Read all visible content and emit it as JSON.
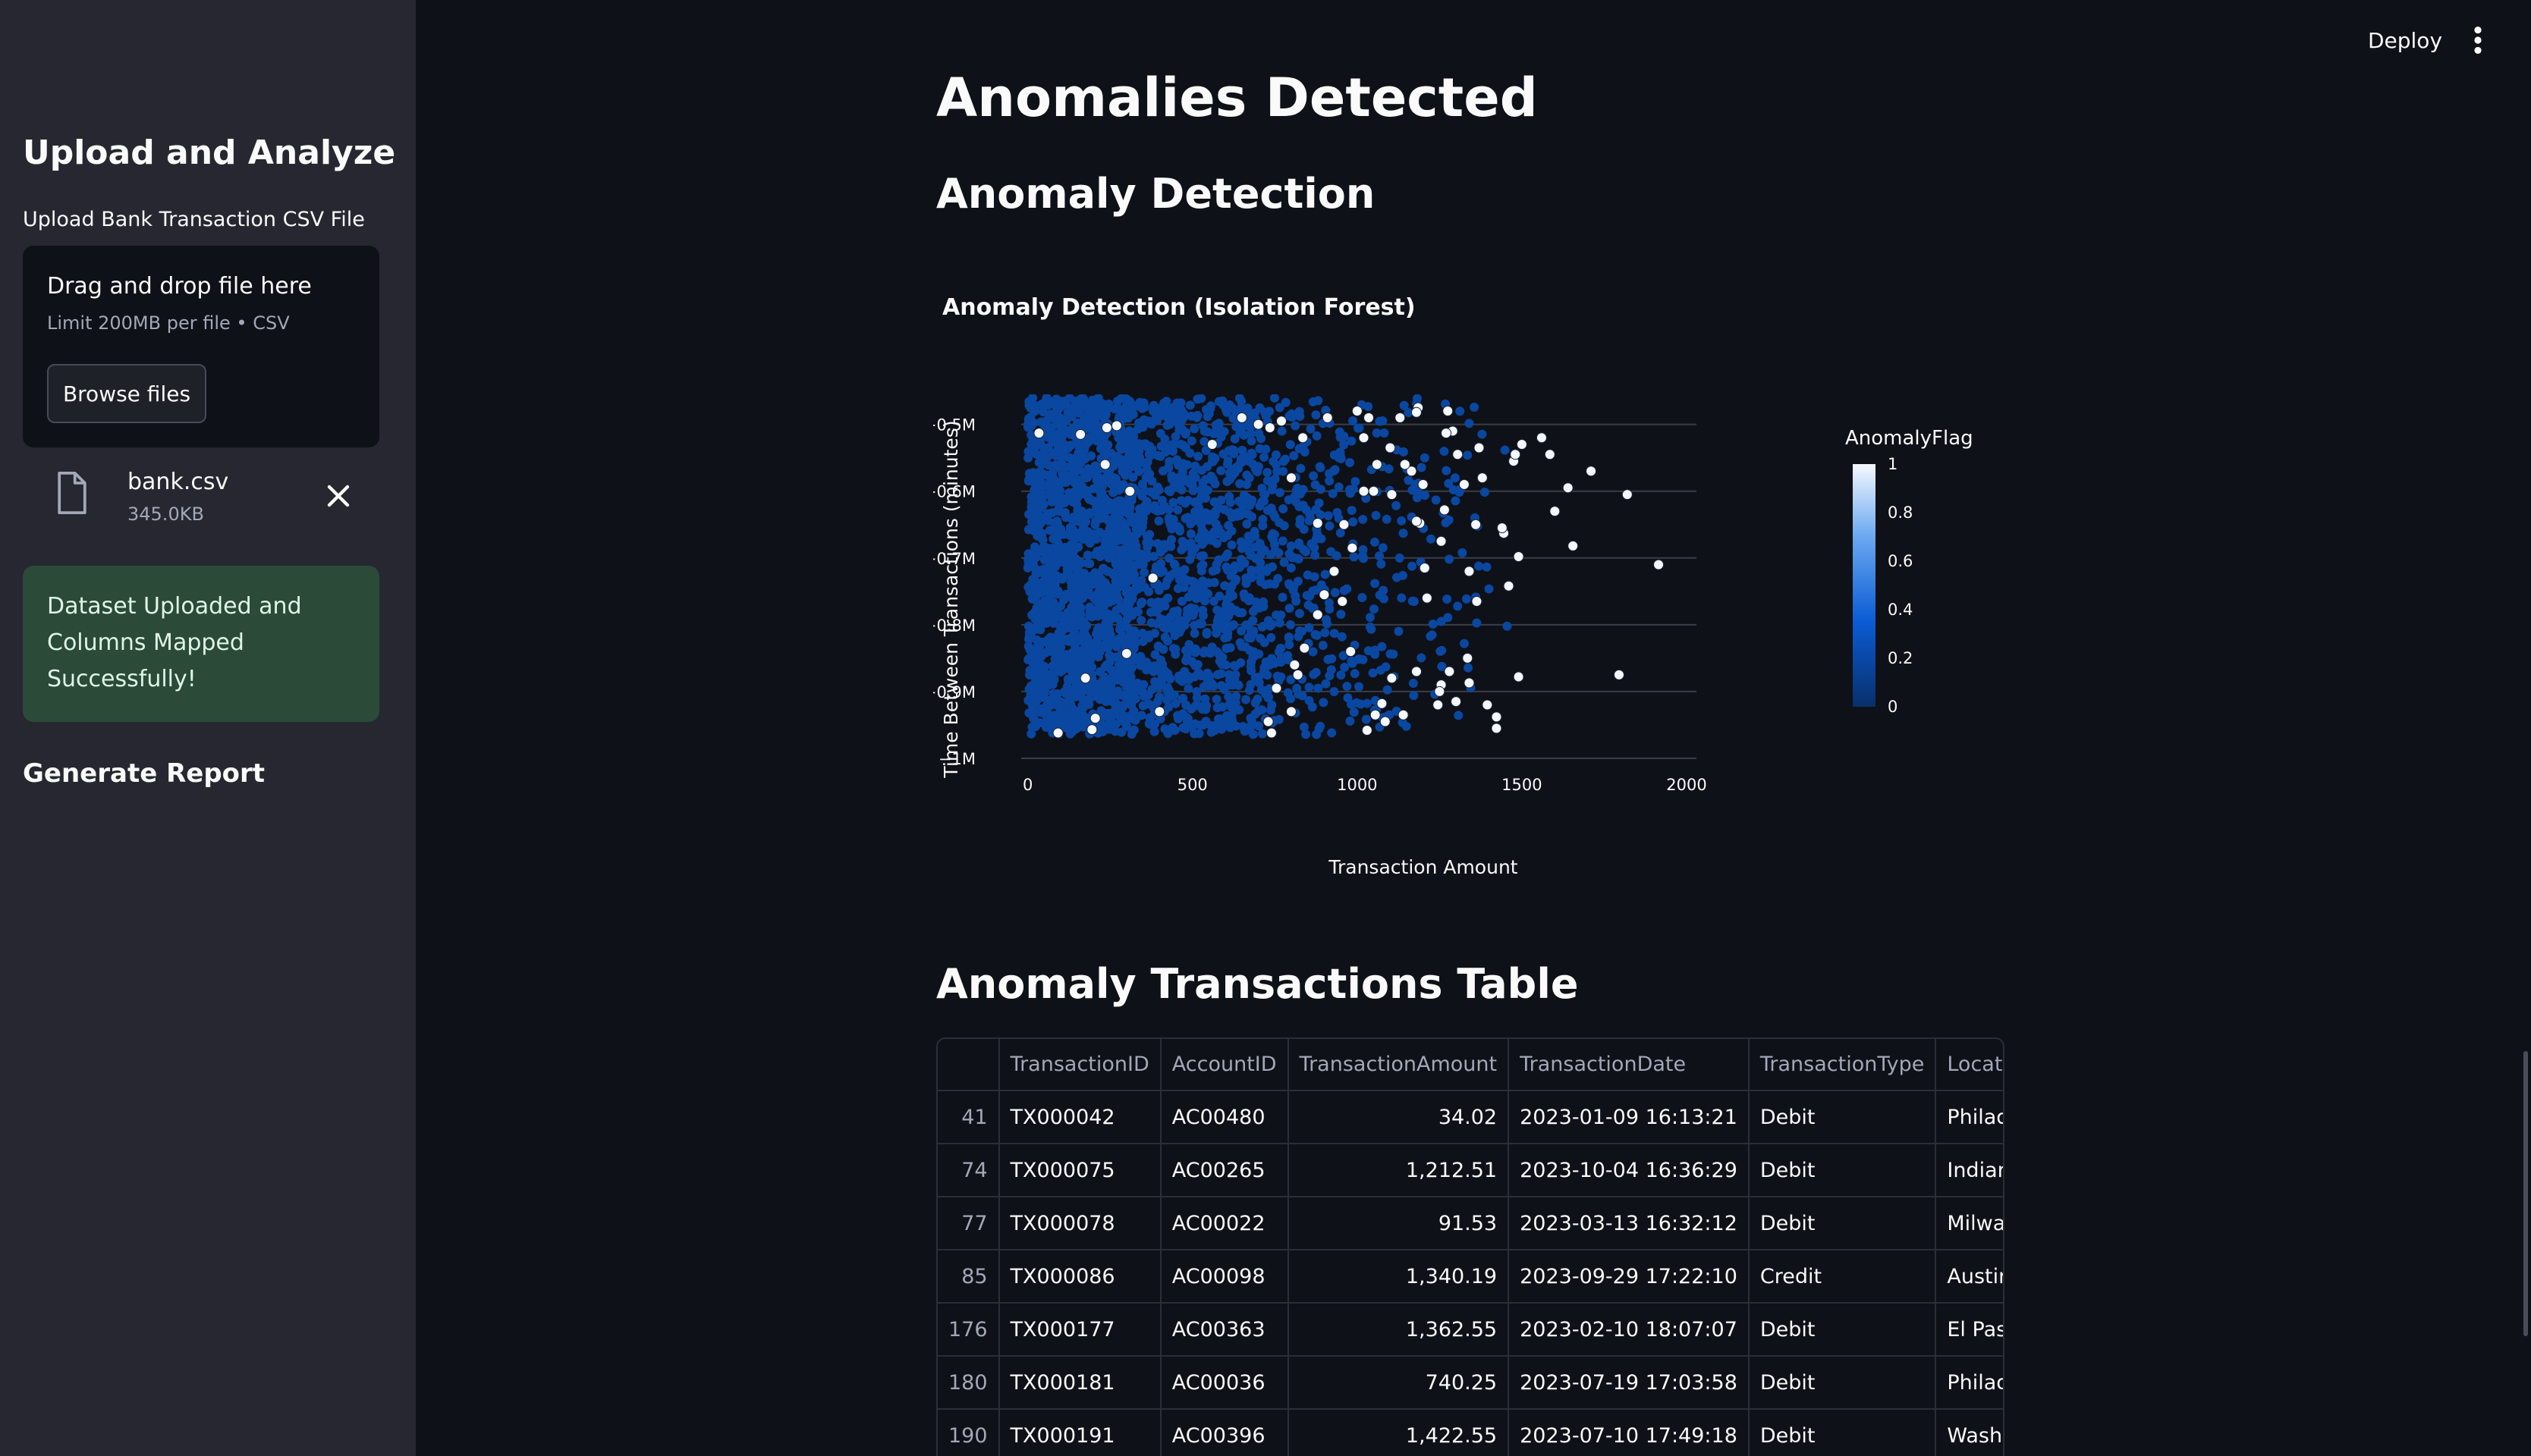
{
  "header": {
    "deploy_label": "Deploy",
    "menu_icon": "more-vertical-icon"
  },
  "sidebar": {
    "title": "Upload and Analyze",
    "upload_label": "Upload Bank Transaction CSV File",
    "dropzone": {
      "text": "Drag and drop file here",
      "limit": "Limit 200MB per file • CSV",
      "browse_label": "Browse files"
    },
    "file": {
      "name": "bank.csv",
      "size": "345.0KB",
      "icon": "file-icon"
    },
    "success_message": "Dataset Uploaded and Columns Mapped Successfully!",
    "report_label": "Generate Report"
  },
  "main": {
    "heading": "Anomalies Detected",
    "subheading": "Anomaly Detection",
    "chart_title": "Anomaly Detection (Isolation Forest)",
    "table_title": "Anomaly Transactions Table"
  },
  "chart_data": {
    "type": "scatter",
    "title": "Anomaly Detection (Isolation Forest)",
    "xlabel": "Transaction Amount",
    "ylabel": "Time Between Transactions (minutes)",
    "xlim": [
      -20,
      2030
    ],
    "ylim": [
      -1000000,
      -455000
    ],
    "x_ticks": [
      0,
      500,
      1000,
      1500,
      2000
    ],
    "x_tick_labels": [
      "0",
      "500",
      "1000",
      "1500",
      "2000"
    ],
    "y_ticks": [
      -500000,
      -600000,
      -700000,
      -800000,
      -900000,
      -1000000
    ],
    "y_tick_labels": [
      "−0.5M",
      "−0.6M",
      "−0.7M",
      "−0.8M",
      "−0.9M",
      "−1M"
    ],
    "grid": true,
    "colorbar": {
      "title": "AnomalyFlag",
      "min": 0,
      "max": 1,
      "ticks": [
        "0",
        "0.2",
        "0.4",
        "0.6",
        "0.8",
        "1"
      ],
      "colors": [
        "#08306b",
        "#0a5bd3",
        "#6aa8f0",
        "#f4f8ff"
      ]
    },
    "normal_color": "#0a47a0",
    "anomaly_color": "#f4f8ff",
    "anomalies": [
      [
        34,
        -513000
      ],
      [
        1212,
        -760000
      ],
      [
        92,
        -962000
      ],
      [
        1340,
        -720000
      ],
      [
        1363,
        -765000
      ],
      [
        740,
        -962000
      ],
      [
        1423,
        -938000
      ],
      [
        1640,
        -595000
      ],
      [
        1710,
        -570000
      ],
      [
        1820,
        -605000
      ],
      [
        1915,
        -710000
      ],
      [
        1795,
        -875000
      ],
      [
        1490,
        -878000
      ],
      [
        1585,
        -545000
      ],
      [
        1500,
        -530000
      ],
      [
        1290,
        -510000
      ],
      [
        1130,
        -490000
      ],
      [
        1200,
        -590000
      ],
      [
        1105,
        -605000
      ],
      [
        1265,
        -628000
      ],
      [
        1050,
        -600000
      ],
      [
        1380,
        -580000
      ],
      [
        1475,
        -555000
      ],
      [
        1460,
        -742000
      ],
      [
        1445,
        -663000
      ],
      [
        1255,
        -675000
      ],
      [
        1300,
        -915000
      ],
      [
        1180,
        -870000
      ],
      [
        1140,
        -935000
      ],
      [
        1105,
        -880000
      ],
      [
        1075,
        -918000
      ],
      [
        1030,
        -958000
      ],
      [
        1395,
        -920000
      ],
      [
        1423,
        -955000
      ],
      [
        1340,
        -887000
      ],
      [
        1255,
        -890000
      ],
      [
        1245,
        -920000
      ],
      [
        1035,
        -490000
      ],
      [
        1000,
        -480000
      ],
      [
        910,
        -490000
      ],
      [
        880,
        -648000
      ],
      [
        955,
        -765000
      ],
      [
        980,
        -840000
      ],
      [
        1020,
        -520000
      ],
      [
        1060,
        -560000
      ],
      [
        1250,
        -900000
      ],
      [
        1280,
        -870000
      ],
      [
        800,
        -580000
      ],
      [
        835,
        -520000
      ],
      [
        770,
        -495000
      ],
      [
        700,
        -500000
      ],
      [
        650,
        -490000
      ],
      [
        560,
        -530000
      ],
      [
        380,
        -730000
      ],
      [
        400,
        -930000
      ],
      [
        310,
        -600000
      ],
      [
        270,
        -502000
      ],
      [
        240,
        -505000
      ],
      [
        160,
        -515000
      ],
      [
        235,
        -560000
      ],
      [
        300,
        -843000
      ],
      [
        205,
        -940000
      ],
      [
        195,
        -957000
      ],
      [
        175,
        -880000
      ],
      [
        1055,
        -935000
      ],
      [
        1085,
        -945000
      ],
      [
        900,
        -755000
      ],
      [
        820,
        -875000
      ],
      [
        800,
        -930000
      ],
      [
        730,
        -945000
      ],
      [
        735,
        -505000
      ],
      [
        1165,
        -570000
      ],
      [
        1190,
        -648000
      ],
      [
        1205,
        -715000
      ],
      [
        1335,
        -850000
      ],
      [
        1180,
        -645000
      ],
      [
        1325,
        -590000
      ],
      [
        1440,
        -655000
      ],
      [
        1560,
        -520000
      ],
      [
        1360,
        -650000
      ],
      [
        1145,
        -560000
      ],
      [
        1100,
        -535000
      ],
      [
        1020,
        -600000
      ],
      [
        960,
        -650000
      ],
      [
        985,
        -685000
      ],
      [
        930,
        -720000
      ],
      [
        880,
        -785000
      ],
      [
        840,
        -835000
      ],
      [
        810,
        -860000
      ],
      [
        755,
        -895000
      ],
      [
        1305,
        -545000
      ],
      [
        1275,
        -480000
      ],
      [
        1185,
        -475000
      ],
      [
        1490,
        -698000
      ],
      [
        1180,
        -482000
      ],
      [
        1480,
        -545000
      ],
      [
        1600,
        -630000
      ],
      [
        1655,
        -682000
      ],
      [
        1270,
        -513000
      ],
      [
        1370,
        -535000
      ]
    ],
    "normal_summary": "dense cluster of points with AnomalyFlag 0 spanning Transaction Amount 0 to about 1500 (densest 0–600) and Time Between Transactions −0.97M to −0.46M"
  },
  "table": {
    "columns": [
      "",
      "TransactionID",
      "AccountID",
      "TransactionAmount",
      "TransactionDate",
      "TransactionType",
      "Location"
    ],
    "rows": [
      [
        "41",
        "TX000042",
        "AC00480",
        "34.02",
        "2023-01-09 16:13:21",
        "Debit",
        "Philadelphia"
      ],
      [
        "74",
        "TX000075",
        "AC00265",
        "1,212.51",
        "2023-10-04 16:36:29",
        "Debit",
        "Indianapolis"
      ],
      [
        "77",
        "TX000078",
        "AC00022",
        "91.53",
        "2023-03-13 16:32:12",
        "Debit",
        "Milwaukee"
      ],
      [
        "85",
        "TX000086",
        "AC00098",
        "1,340.19",
        "2023-09-29 17:22:10",
        "Credit",
        "Austin"
      ],
      [
        "176",
        "TX000177",
        "AC00363",
        "1,362.55",
        "2023-02-10 18:07:07",
        "Debit",
        "El Paso"
      ],
      [
        "180",
        "TX000181",
        "AC00036",
        "740.25",
        "2023-07-19 17:03:58",
        "Debit",
        "Philadelphia"
      ],
      [
        "190",
        "TX000191",
        "AC00396",
        "1,422.55",
        "2023-07-10 17:49:18",
        "Debit",
        "Washington"
      ]
    ]
  }
}
